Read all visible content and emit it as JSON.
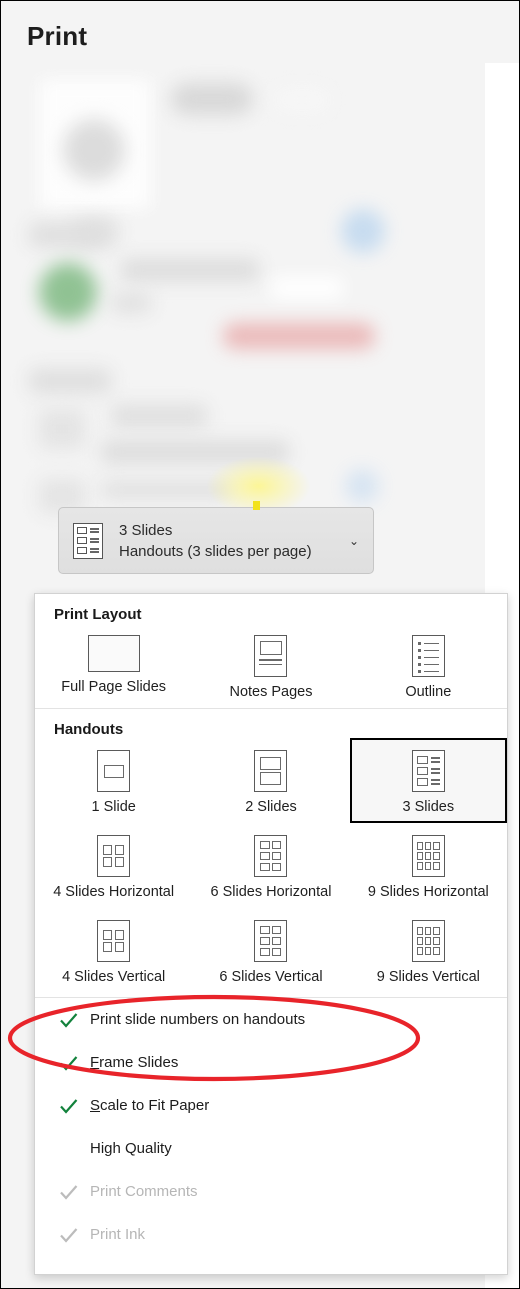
{
  "window": {
    "title": "Print",
    "background_color": "#f3f3f3"
  },
  "combo": {
    "name": "print-layout-combo",
    "line1": "3 Slides",
    "line2": "Handouts (3 slides per page)",
    "chevron": "chevron-down-icon",
    "icon": "handout-3-slides-icon"
  },
  "menu": {
    "sections": [
      {
        "title": "Print Layout",
        "items": [
          {
            "label": "Full Page Slides",
            "icon": "full-page-slide-icon",
            "selected": false
          },
          {
            "label": "Notes Pages",
            "icon": "notes-page-icon",
            "selected": false
          },
          {
            "label": "Outline",
            "icon": "outline-icon",
            "selected": false
          }
        ]
      },
      {
        "title": "Handouts",
        "rows": [
          [
            {
              "label": "1 Slide",
              "icon": "handout-1-slide-icon",
              "selected": false
            },
            {
              "label": "2 Slides",
              "icon": "handout-2-slides-icon",
              "selected": false
            },
            {
              "label": "3 Slides",
              "icon": "handout-3-slides-icon",
              "selected": true
            }
          ],
          [
            {
              "label": "4 Slides Horizontal",
              "icon": "handout-4-horizontal-icon",
              "selected": false
            },
            {
              "label": "6 Slides Horizontal",
              "icon": "handout-6-horizontal-icon",
              "selected": false
            },
            {
              "label": "9 Slides Horizontal",
              "icon": "handout-9-horizontal-icon",
              "selected": false
            }
          ],
          [
            {
              "label": "4 Slides Vertical",
              "icon": "handout-4-vertical-icon",
              "selected": false
            },
            {
              "label": "6 Slides Vertical",
              "icon": "handout-6-vertical-icon",
              "selected": false
            },
            {
              "label": "9 Slides Vertical",
              "icon": "handout-9-vertical-icon",
              "selected": false
            }
          ]
        ]
      }
    ],
    "options": [
      {
        "label": "Print slide numbers on handouts",
        "checked": true,
        "enabled": true,
        "accel": ""
      },
      {
        "label": "Frame Slides",
        "checked": true,
        "enabled": true,
        "accel": "F"
      },
      {
        "label": "Scale to Fit Paper",
        "checked": true,
        "enabled": true,
        "accel": "S"
      },
      {
        "label": "High Quality",
        "checked": false,
        "enabled": true,
        "accel": ""
      },
      {
        "label": "Print Comments",
        "checked": true,
        "enabled": false,
        "accel": ""
      },
      {
        "label": "Print Ink",
        "checked": true,
        "enabled": false,
        "accel": ""
      }
    ]
  },
  "annotation": {
    "shape": "ellipse",
    "color": "#e8242a",
    "targets": "Print slide numbers on handouts"
  },
  "colors": {
    "check_enabled": "#12823c",
    "check_disabled": "#bcbcbc",
    "selection_border": "#000000",
    "annotation_red": "#e8242a",
    "highlight_yellow": "#f2e21c"
  }
}
